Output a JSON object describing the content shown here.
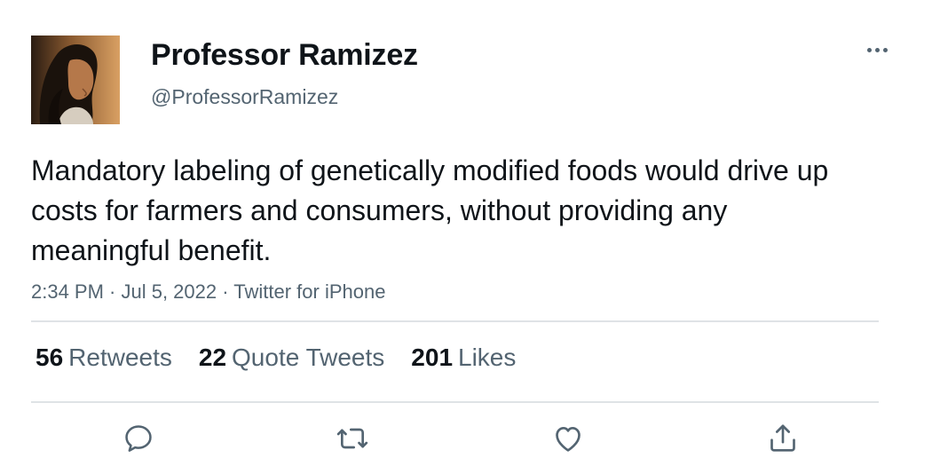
{
  "author": {
    "display_name": "Professor Ramizez",
    "handle": "@ProfessorRamizez"
  },
  "tweet": {
    "text": "Mandatory labeling of genetically modified foods would drive up costs for farmers and consumers, without providing any meaningful benefit.",
    "meta": "2:34 PM · Jul 5, 2022 · Twitter for iPhone"
  },
  "stats": {
    "retweets_count": "56",
    "retweets_label": "Retweets",
    "quotes_count": "22",
    "quotes_label": "Quote Tweets",
    "likes_count": "201",
    "likes_label": "Likes"
  },
  "actions": {
    "reply_icon": "reply-icon",
    "retweet_icon": "retweet-icon",
    "like_icon": "heart-icon",
    "share_icon": "share-icon",
    "more_icon": "more-icon"
  },
  "colors": {
    "text": "#0f1419",
    "secondary": "#536471",
    "divider": "#dfe3e6"
  }
}
